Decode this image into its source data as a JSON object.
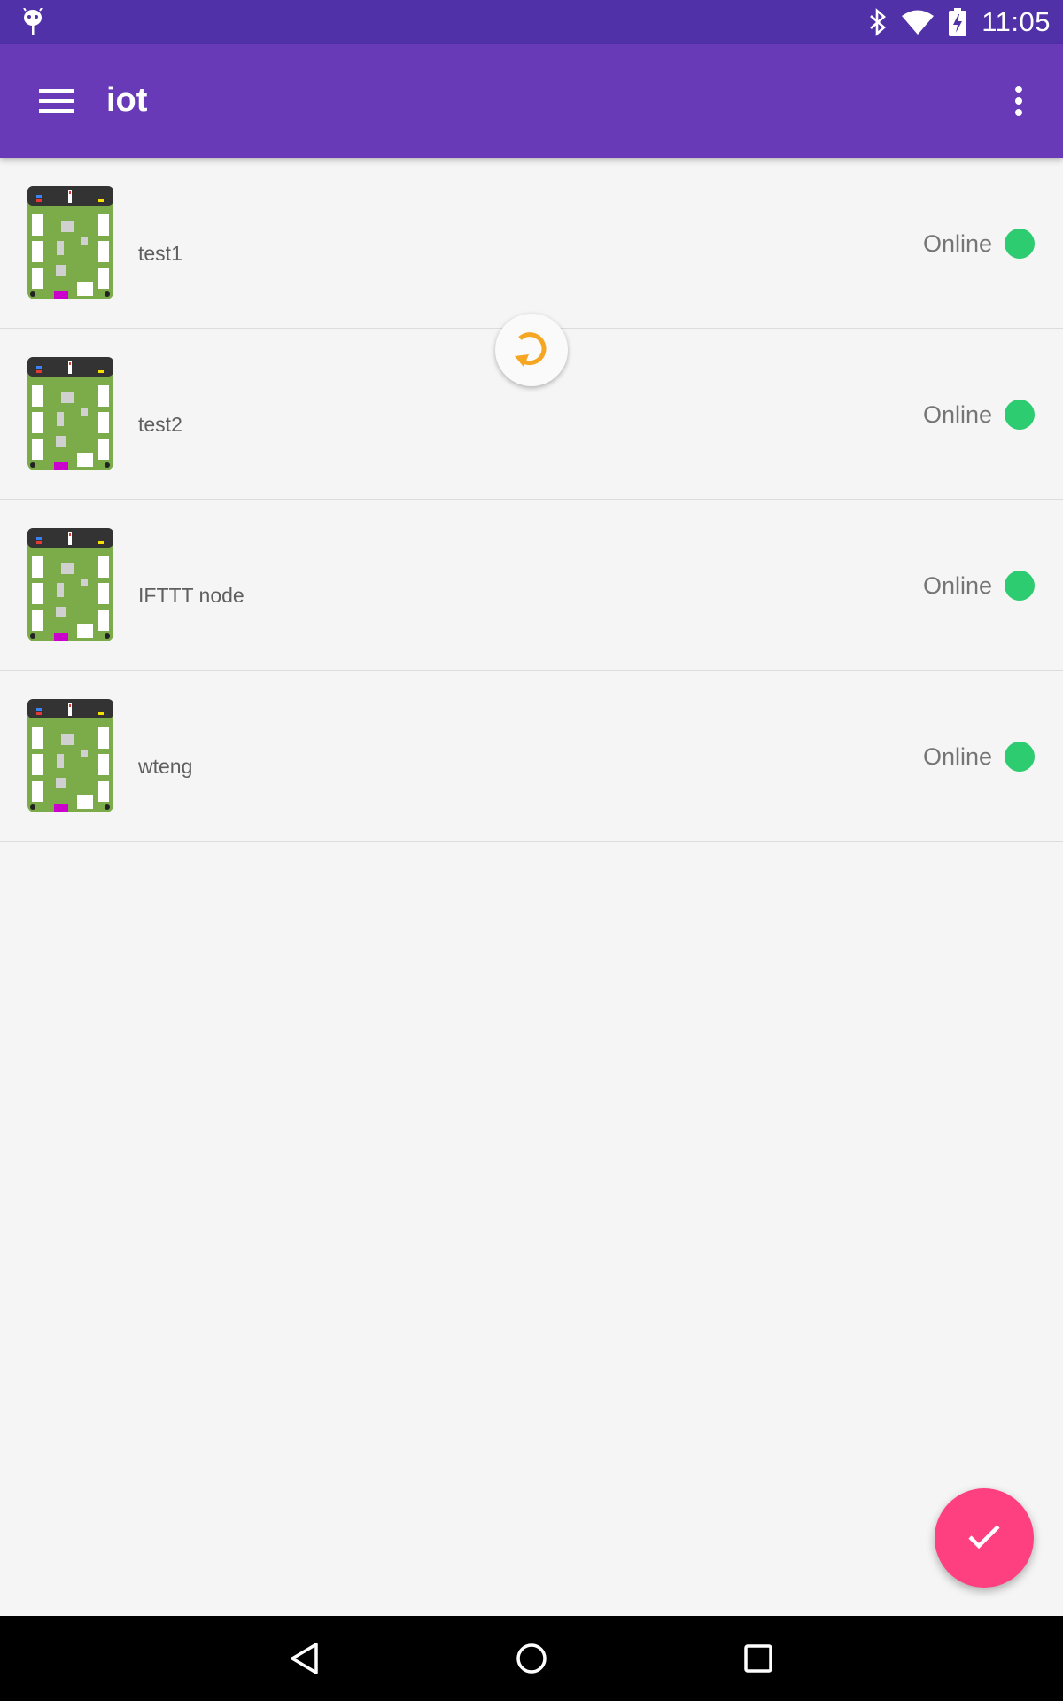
{
  "status_bar": {
    "time": "11:05",
    "icons": [
      "android-debug-icon",
      "bluetooth-icon",
      "wifi-icon",
      "battery-charging-icon"
    ]
  },
  "app_bar": {
    "title": "iot",
    "menu_icon": "hamburger-menu-icon",
    "overflow_icon": "more-vert-icon"
  },
  "devices": [
    {
      "name": "test1",
      "status": "Online",
      "status_color": "#2ecc71"
    },
    {
      "name": "test2",
      "status": "Online",
      "status_color": "#2ecc71"
    },
    {
      "name": "IFTTT node",
      "status": "Online",
      "status_color": "#2ecc71"
    },
    {
      "name": "wteng",
      "status": "Online",
      "status_color": "#2ecc71"
    }
  ],
  "refresh": {
    "icon": "refresh-icon",
    "color": "#f5a623"
  },
  "fab": {
    "icon": "check-icon",
    "color": "#fe4081"
  },
  "nav_bar": {
    "icons": [
      "back-icon",
      "home-icon",
      "recents-icon"
    ]
  },
  "colors": {
    "status_bar": "#5131a8",
    "app_bar": "#683ab7",
    "background": "#f5f5f5"
  }
}
